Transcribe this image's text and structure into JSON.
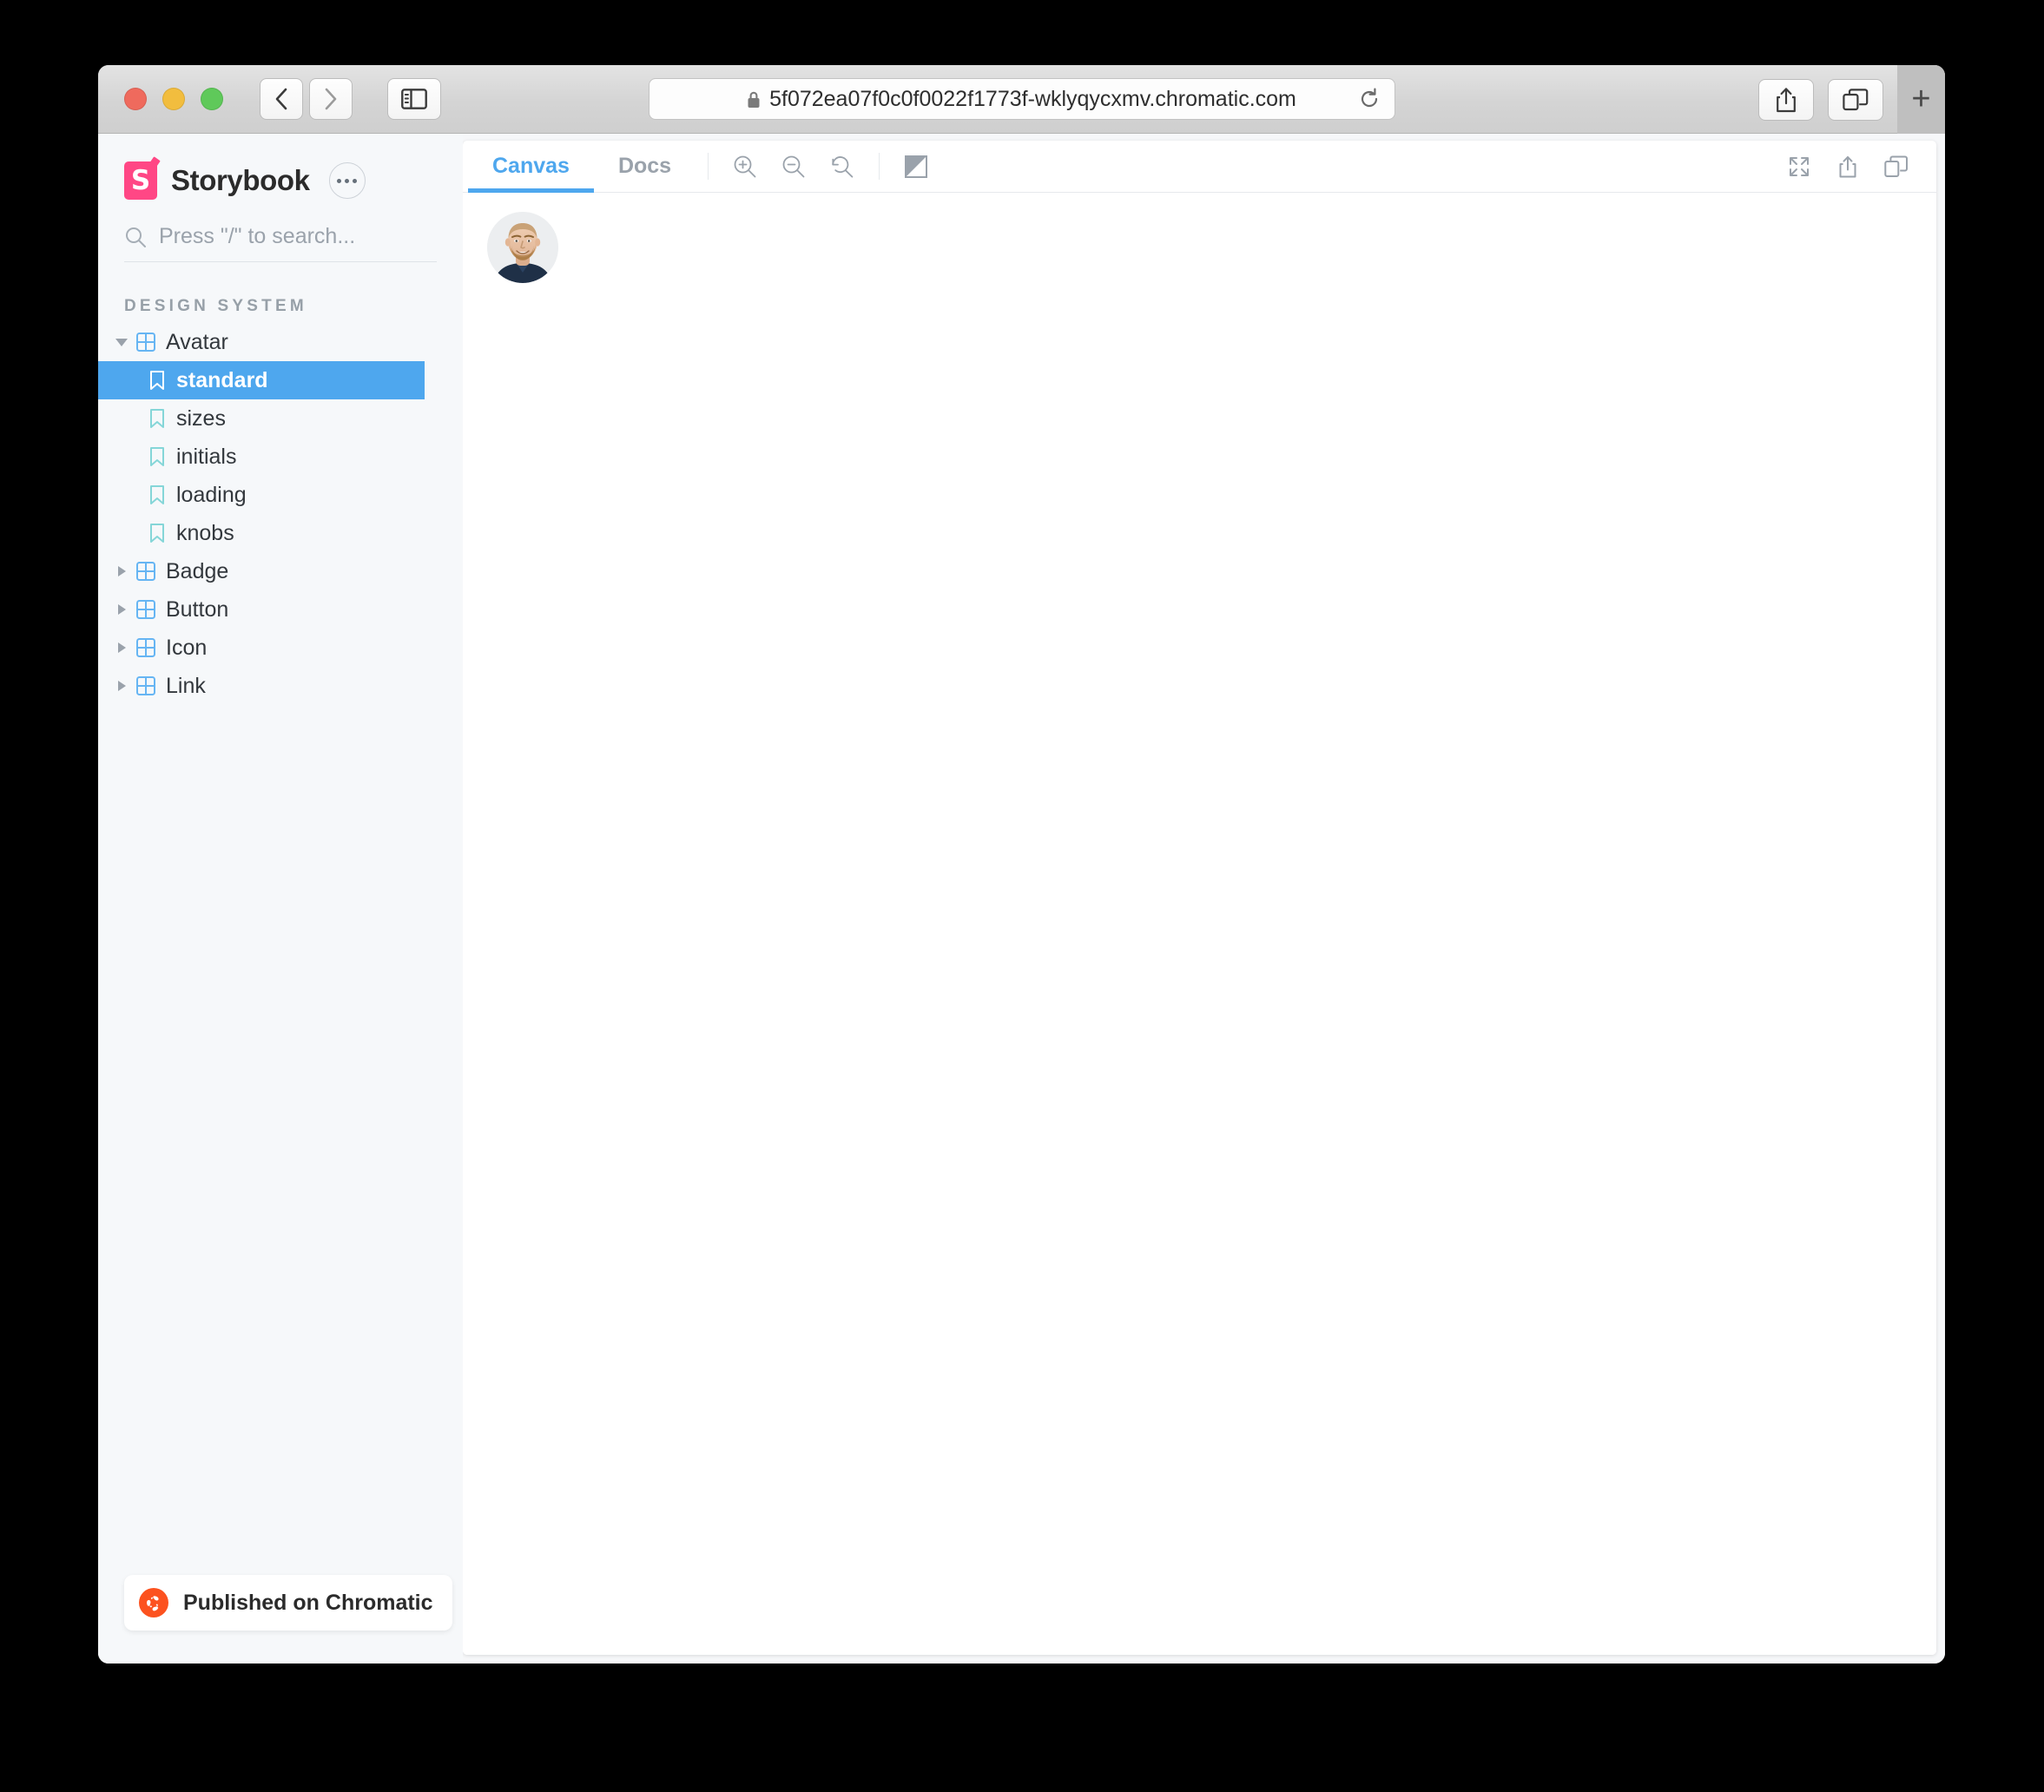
{
  "browser": {
    "url": "5f072ea07f0c0f0022f1773f-wklyqycxmv.chromatic.com",
    "back_label": "Back",
    "forward_label": "Forward",
    "sidebar_toggle_label": "Show sidebar",
    "reload_label": "Reload",
    "share_label": "Share",
    "tab_overview_label": "Tab Overview",
    "new_tab_label": "+"
  },
  "sidebar": {
    "brand": "Storybook",
    "logo_letter": "S",
    "menu_label": "More",
    "search": {
      "placeholder": "Press \"/\" to search...",
      "value": ""
    },
    "section_label": "DESIGN SYSTEM",
    "tree": [
      {
        "label": "Avatar",
        "type": "component",
        "expanded": true,
        "selected": false
      },
      {
        "label": "standard",
        "type": "story",
        "expanded": false,
        "selected": true
      },
      {
        "label": "sizes",
        "type": "story",
        "expanded": false,
        "selected": false
      },
      {
        "label": "initials",
        "type": "story",
        "expanded": false,
        "selected": false
      },
      {
        "label": "loading",
        "type": "story",
        "expanded": false,
        "selected": false
      },
      {
        "label": "knobs",
        "type": "story",
        "expanded": false,
        "selected": false
      },
      {
        "label": "Badge",
        "type": "component",
        "expanded": false,
        "selected": false
      },
      {
        "label": "Button",
        "type": "component",
        "expanded": false,
        "selected": false
      },
      {
        "label": "Icon",
        "type": "component",
        "expanded": false,
        "selected": false
      },
      {
        "label": "Link",
        "type": "component",
        "expanded": false,
        "selected": false
      }
    ],
    "chromatic_badge": "Published on Chromatic"
  },
  "canvas": {
    "tabs": [
      {
        "label": "Canvas",
        "active": true
      },
      {
        "label": "Docs",
        "active": false
      }
    ],
    "tools": [
      {
        "name": "zoom-in-icon",
        "label": "Zoom in"
      },
      {
        "name": "zoom-out-icon",
        "label": "Zoom out"
      },
      {
        "name": "zoom-reset-icon",
        "label": "Reset zoom"
      },
      {
        "name": "background-toggle-icon",
        "label": "Change background"
      }
    ],
    "right_tools": [
      {
        "name": "expand-icon",
        "label": "Go full screen"
      },
      {
        "name": "share-icon",
        "label": "Open canvas in new tab"
      },
      {
        "name": "copy-icon",
        "label": "Copy canvas link"
      }
    ],
    "preview": {
      "story": "standard",
      "component": "Avatar"
    }
  },
  "colors": {
    "accent": "#4EA7EE",
    "brand_pink": "#FF4785",
    "chromatic_orange": "#FC521F",
    "sidebar_bg": "#F6F8FA",
    "text": "#33383D",
    "muted": "#9AA2AB"
  }
}
